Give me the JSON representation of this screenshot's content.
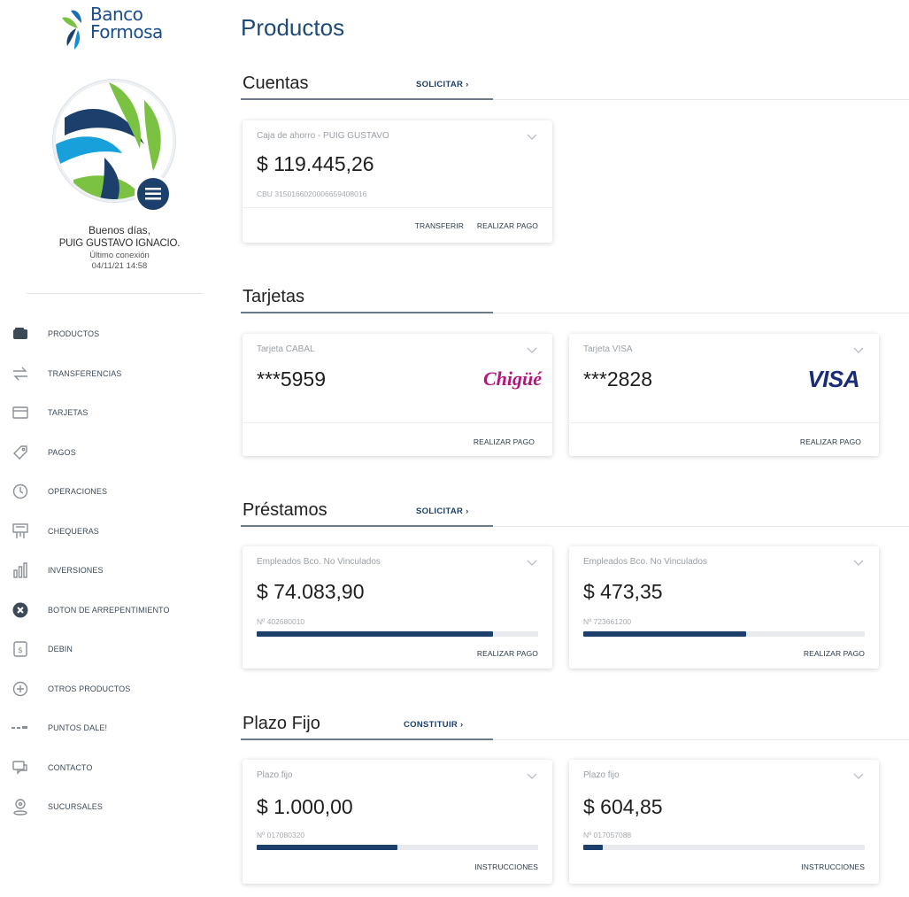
{
  "brand": {
    "line1": "Banco",
    "line2": "Formosa"
  },
  "user": {
    "greeting": "Buenos días,",
    "name": "PUIG GUSTAVO IGNACIO.",
    "last_login_label": "Último conexión",
    "last_login_value": "04/11/21 14:58"
  },
  "nav": [
    {
      "label": "PRODUCTOS",
      "icon": "wallet-icon"
    },
    {
      "label": "TRANSFERENCIAS",
      "icon": "transfer-icon"
    },
    {
      "label": "TARJETAS",
      "icon": "card-icon"
    },
    {
      "label": "PAGOS",
      "icon": "tag-icon"
    },
    {
      "label": "OPERACIONES",
      "icon": "clock-icon"
    },
    {
      "label": "CHEQUERAS",
      "icon": "checkbook-icon"
    },
    {
      "label": "INVERSIONES",
      "icon": "investments-icon"
    },
    {
      "label": "BOTON DE ARREPENTIMIENTO",
      "icon": "cancel-icon"
    },
    {
      "label": "DEBIN",
      "icon": "debin-icon"
    },
    {
      "label": "OTROS PRODUCTOS",
      "icon": "plus-circle-icon"
    },
    {
      "label": "PUNTOS DALE!",
      "icon": "points-icon"
    },
    {
      "label": "CONTACTO",
      "icon": "contact-icon"
    },
    {
      "label": "SUCURSALES",
      "icon": "branch-icon"
    }
  ],
  "page": {
    "title": "Productos"
  },
  "sections": {
    "cuentas": {
      "title": "Cuentas",
      "action": "SOLICITAR",
      "cards": [
        {
          "label": "Caja de ahorro - PUIG GUSTAVO",
          "amount": "$ 119.445,26",
          "sub": "CBU 3150166020006659408016",
          "actions": [
            "TRANSFERIR",
            "REALIZAR PAGO"
          ]
        }
      ]
    },
    "tarjetas": {
      "title": "Tarjetas",
      "cards": [
        {
          "label": "Tarjeta CABAL",
          "amount": "***5959",
          "brand": "Chigüé",
          "actions": [
            "REALIZAR PAGO"
          ]
        },
        {
          "label": "Tarjeta VISA",
          "amount": "***2828",
          "brand": "VISA",
          "actions": [
            "REALIZAR PAGO"
          ]
        }
      ]
    },
    "prestamos": {
      "title": "Préstamos",
      "action": "SOLICITAR",
      "cards": [
        {
          "label": "Empleados Bco. No Vinculados",
          "amount": "$ 74.083,90",
          "sub": "Nº 402680010",
          "progress": 0.84,
          "actions": [
            "REALIZAR PAGO"
          ]
        },
        {
          "label": "Empleados Bco. No Vinculados",
          "amount": "$ 473,35",
          "sub": "Nº 723661200",
          "progress": 0.58,
          "actions": [
            "REALIZAR PAGO"
          ]
        }
      ]
    },
    "plazo_fijo": {
      "title": "Plazo Fijo",
      "action": "CONSTITUIR",
      "cards": [
        {
          "label": "Plazo fijo",
          "amount": "$ 1.000,00",
          "sub": "Nº 017080320",
          "progress": 0.5,
          "actions": [
            "INSTRUCCIONES"
          ]
        },
        {
          "label": "Plazo fijo",
          "amount": "$ 604,85",
          "sub": "Nº 017057088",
          "progress": 0.07,
          "actions": [
            "INSTRUCCIONES"
          ]
        }
      ]
    }
  },
  "colors": {
    "primary": "#1c3f6b",
    "title": "#1d4a77",
    "chigue": "#b5157a",
    "visa": "#1a2b7a"
  }
}
